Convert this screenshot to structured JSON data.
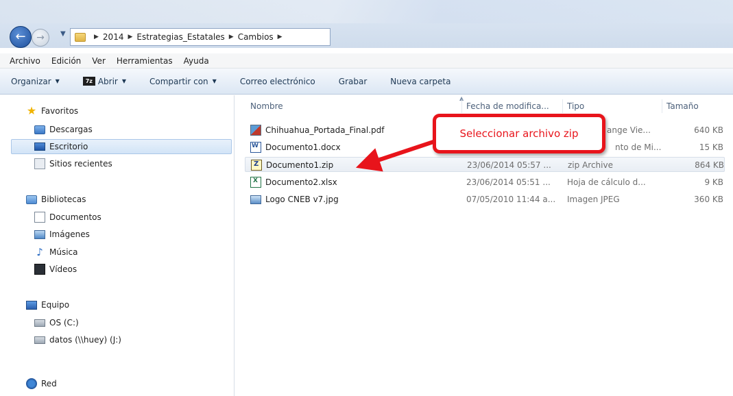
{
  "address": {
    "crumbs": [
      "2014",
      "Estrategias_Estatales",
      "Cambios"
    ]
  },
  "menu": [
    "Archivo",
    "Edición",
    "Ver",
    "Herramientas",
    "Ayuda"
  ],
  "commands": {
    "organize": "Organizar",
    "open": "Abrir",
    "share": "Compartir con",
    "email": "Correo electrónico",
    "burn": "Grabar",
    "new_folder": "Nueva carpeta"
  },
  "nav": {
    "favorites": "Favoritos",
    "downloads": "Descargas",
    "desktop": "Escritorio",
    "recent": "Sitios recientes",
    "libraries": "Bibliotecas",
    "documents": "Documentos",
    "images": "Imágenes",
    "music": "Música",
    "videos": "Vídeos",
    "computer": "Equipo",
    "drive_c": "OS (C:)",
    "drive_j": "datos (\\\\huey) (J:)",
    "network": "Red"
  },
  "columns": {
    "name": "Nombre",
    "date": "Fecha de modifica...",
    "type": "Tipo",
    "size": "Tamaño"
  },
  "files": [
    {
      "name": "Chihuahua_Portada_Final.pdf",
      "date": "",
      "type": "ange Vie...",
      "size": "640 KB",
      "icon": "pdf-icon"
    },
    {
      "name": "Documento1.docx",
      "date": "",
      "type": "nto de Mi...",
      "size": "15 KB",
      "icon": "word-icon"
    },
    {
      "name": "Documento1.zip",
      "date": "23/06/2014 05:57 ...",
      "type": "zip Archive",
      "size": "864 KB",
      "icon": "zip-icon"
    },
    {
      "name": "Documento2.xlsx",
      "date": "23/06/2014 05:51 ...",
      "type": "Hoja de cálculo d...",
      "size": "9 KB",
      "icon": "excel-icon"
    },
    {
      "name": "Logo CNEB v7.jpg",
      "date": "07/05/2010 11:44 a...",
      "type": "Imagen JPEG",
      "size": "360 KB",
      "icon": "image-icon"
    }
  ],
  "callout": {
    "text": "Seleccionar archivo zip",
    "color": "#e8141b"
  }
}
